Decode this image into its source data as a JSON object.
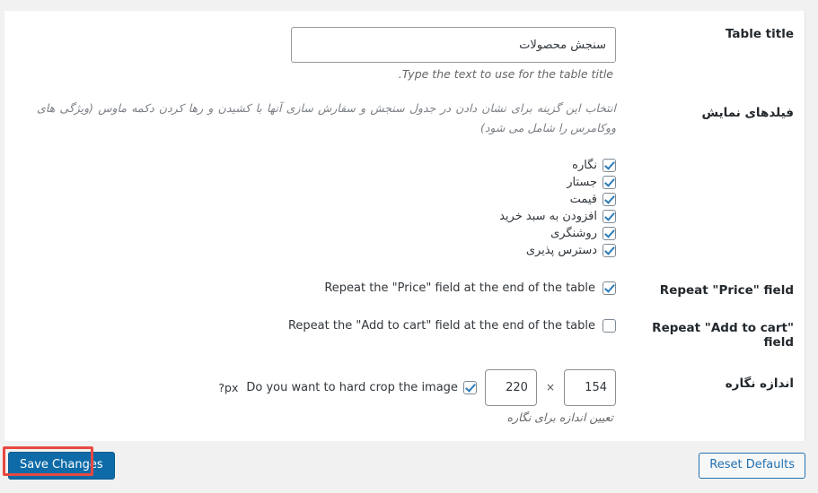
{
  "window": {
    "background_color": "#f1f1f1",
    "panel_color": "#ffffff"
  },
  "settings_rows": [
    {
      "id": "table-title",
      "label": "Table title",
      "input_value": "سنجش محصولات",
      "input_placeholder": "",
      "help": ".Type the text to use for the table title"
    },
    {
      "id": "display-fields",
      "label": "فیلدهای نمایش",
      "description": "انتخاب این گزینه برای نشان دادن در جدول سنجش و سفارش سازی آنها با کشیدن و رها کردن دکمه ماوس (ویژگی های ووکامرس را شامل می شود)",
      "options": [
        {
          "label": "نگاره",
          "checked": true
        },
        {
          "label": "جستار",
          "checked": true
        },
        {
          "label": "قیمت",
          "checked": true
        },
        {
          "label": "افزودن به سبد خرید",
          "checked": true
        },
        {
          "label": "روشنگری",
          "checked": true
        },
        {
          "label": "دسترس پذیری",
          "checked": true
        }
      ]
    },
    {
      "id": "repeat-price",
      "label": "Repeat \"Price\" field",
      "checkbox_label": "Repeat the \"Price\" field at the end of the table",
      "checked": true
    },
    {
      "id": "repeat-add-to-cart",
      "label": "Repeat \"Add to cart\" field",
      "checkbox_label": "Repeat the \"Add to cart\" field at the end of the table",
      "checked": false
    },
    {
      "id": "image-size",
      "label": "اندازه نگاره",
      "width_value": "154",
      "height_value": "220",
      "separator": "×",
      "crop_label": "Do you want to hard crop the image",
      "crop_checked": true,
      "px_note": "?px",
      "help": "تعیین اندازه برای نگاره"
    }
  ],
  "footer": {
    "save_label": "Save Changes",
    "reset_label": "Reset Defaults",
    "save_color": "#0e6ba8",
    "reset_color": "#2271b1",
    "annotation_color": "#e8483f"
  }
}
